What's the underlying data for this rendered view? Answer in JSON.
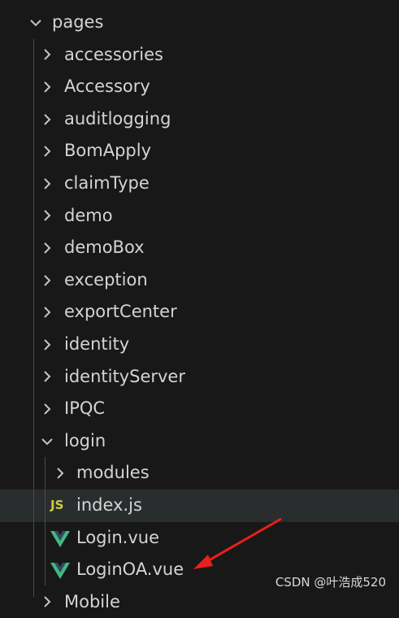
{
  "explorer": {
    "root": {
      "label": "pages",
      "expanded": true
    },
    "folders": [
      {
        "label": "accessories"
      },
      {
        "label": "Accessory"
      },
      {
        "label": "auditlogging"
      },
      {
        "label": "BomApply"
      },
      {
        "label": "claimType"
      },
      {
        "label": "demo"
      },
      {
        "label": "demoBox"
      },
      {
        "label": "exception"
      },
      {
        "label": "exportCenter"
      },
      {
        "label": "identity"
      },
      {
        "label": "identityServer"
      },
      {
        "label": "IPQC"
      }
    ],
    "login_folder": {
      "label": "login",
      "children": {
        "modules": "modules",
        "index_js": "index.js",
        "login_vue": "Login.vue",
        "loginoa_vue": "LoginOA.vue"
      }
    },
    "partial_next_label": "Mobile"
  },
  "icons": {
    "js_badge": "JS",
    "vue": "vue-icon"
  },
  "colors": {
    "background": "#181818",
    "hover_row": "#2a2d2e",
    "text": "#d4d4d4",
    "js_yellow": "#cbcb41",
    "vue_green": "#41b883",
    "annotation_arrow": "#e8201c"
  },
  "watermark": "CSDN @叶浩成520"
}
